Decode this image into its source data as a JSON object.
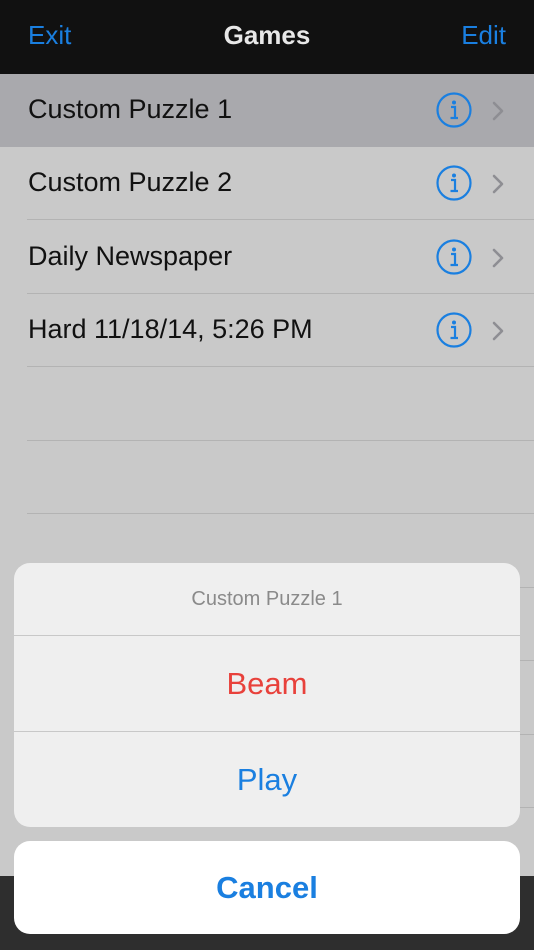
{
  "navbar": {
    "left_label": "Exit",
    "title": "Games",
    "right_label": "Edit"
  },
  "games": [
    {
      "label": "Custom Puzzle 1",
      "selected": true
    },
    {
      "label": "Custom Puzzle 2",
      "selected": false
    },
    {
      "label": "Daily Newspaper",
      "selected": false
    },
    {
      "label": "Hard 11/18/14, 5:26 PM",
      "selected": false
    }
  ],
  "icons": {
    "info": "info-circle-icon",
    "disclosure": "chevron-right-icon"
  },
  "action_sheet": {
    "title": "Custom Puzzle 1",
    "actions": [
      {
        "label": "Beam",
        "style": "destructive"
      },
      {
        "label": "Play",
        "style": "default"
      }
    ],
    "cancel_label": "Cancel"
  },
  "colors": {
    "accent": "#1a7fe0",
    "destructive": "#e8413b",
    "navbar_bg": "#111111"
  }
}
